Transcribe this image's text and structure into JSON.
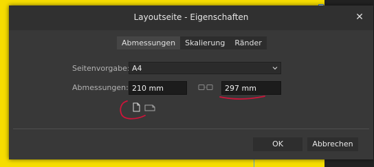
{
  "dialog": {
    "title": "Layoutseite - Eigenschaften",
    "close_symbol": "✕"
  },
  "tabs": [
    {
      "label": "Abmessungen",
      "active": true
    },
    {
      "label": "Skalierung",
      "active": false
    },
    {
      "label": "Ränder",
      "active": false
    }
  ],
  "preset": {
    "label": "Seitenvorgabe:",
    "value": "A4"
  },
  "dimensions": {
    "label": "Abmessungen:",
    "width": "210 mm",
    "height": "297 mm",
    "link_icon": "chain-link-icon"
  },
  "orientation": {
    "portrait_icon": "portrait-page-icon",
    "landscape_icon": "landscape-page-icon",
    "selected": "portrait"
  },
  "buttons": {
    "ok": "OK",
    "cancel": "Abbrechen"
  },
  "colors": {
    "background_yellow": "#f6dd00",
    "dialog": "#383838",
    "annotation_red": "#d0143a"
  }
}
